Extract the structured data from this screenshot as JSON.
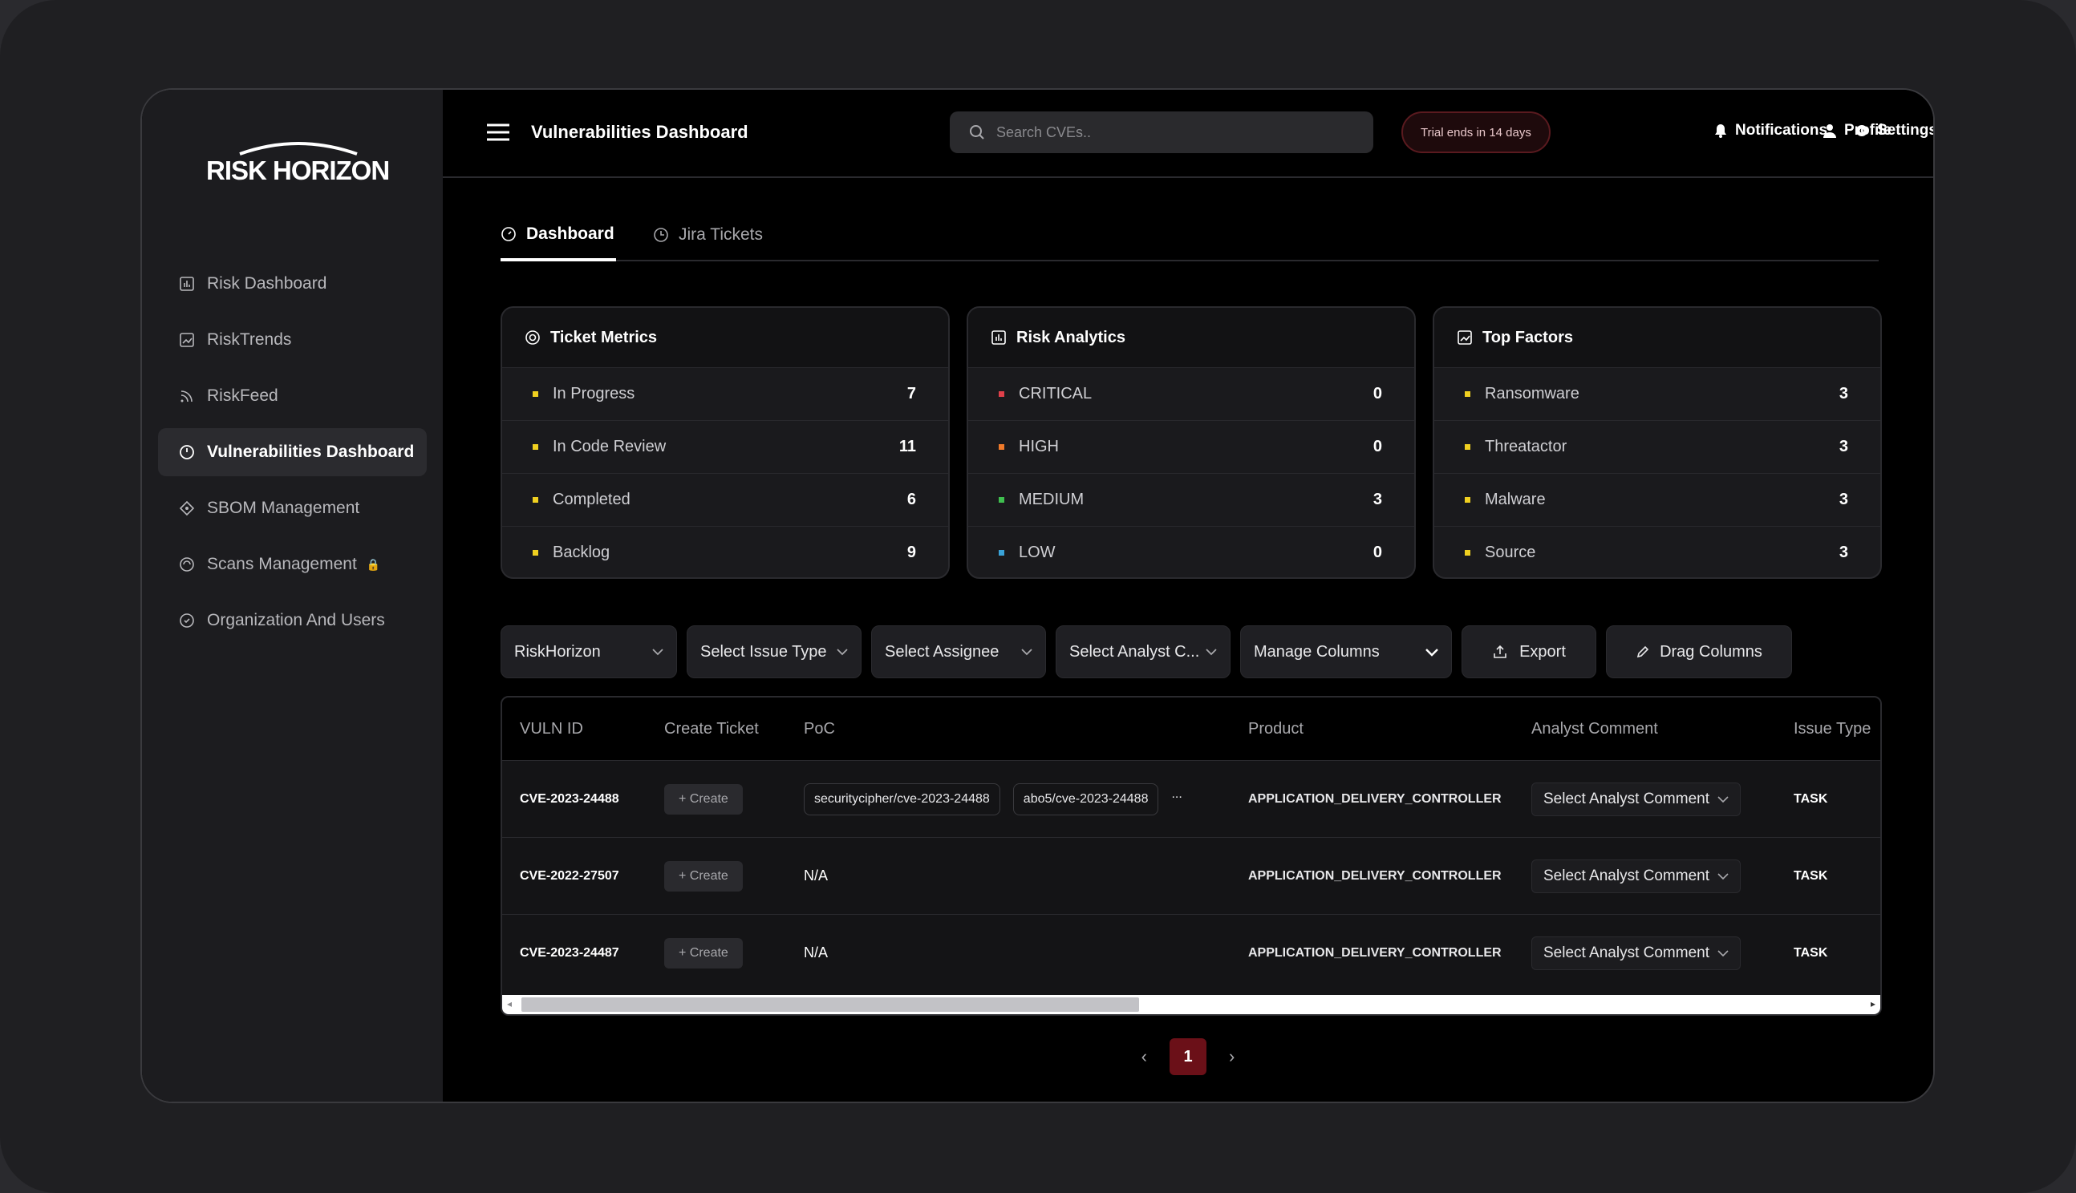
{
  "app": {
    "logo_text": "RISK HORIZON"
  },
  "sidebar": {
    "items": [
      {
        "label": "Risk Dashboard",
        "icon": "bar-chart-icon"
      },
      {
        "label": "RiskTrends",
        "icon": "trend-chart-icon"
      },
      {
        "label": "RiskFeed",
        "icon": "rss-feed-icon"
      },
      {
        "label": "Vulnerabilities Dashboard",
        "icon": "gauge-icon",
        "active": true
      },
      {
        "label": "SBOM Management",
        "icon": "diamond-icon"
      },
      {
        "label": "Scans Management",
        "icon": "scan-icon",
        "locked": true
      },
      {
        "label": "Organization And Users",
        "icon": "users-icon"
      }
    ]
  },
  "header": {
    "title": "Vulnerabilities Dashboard",
    "search_placeholder": "Search CVEs..",
    "trial_badge": "Trial ends in 14 days",
    "notifications": "Notifications",
    "settings": "Settings",
    "profile": "Profile"
  },
  "tabs": {
    "dashboard": "Dashboard",
    "jira": "Jira Tickets"
  },
  "cards": {
    "ticket_metrics": {
      "title": "Ticket Metrics",
      "rows": [
        {
          "label": "In Progress",
          "value": "7"
        },
        {
          "label": "In Code Review",
          "value": "11"
        },
        {
          "label": "Completed",
          "value": "6"
        },
        {
          "label": "Backlog",
          "value": "9"
        }
      ]
    },
    "risk_analytics": {
      "title": "Risk Analytics",
      "rows": [
        {
          "label": "CRITICAL",
          "value": "0",
          "color": "#e0404a"
        },
        {
          "label": "HIGH",
          "value": "0",
          "color": "#f07a2a"
        },
        {
          "label": "MEDIUM",
          "value": "3",
          "color": "#3fbf4f"
        },
        {
          "label": "LOW",
          "value": "0",
          "color": "#3aa3d8"
        }
      ]
    },
    "top_factors": {
      "title": "Top Factors",
      "rows": [
        {
          "label": "Ransomware",
          "value": "3"
        },
        {
          "label": "Threatactor",
          "value": "3"
        },
        {
          "label": "Malware",
          "value": "3"
        },
        {
          "label": "Source",
          "value": "3"
        }
      ]
    },
    "bullet_color": "#f0d020"
  },
  "filters": {
    "org": "RiskHorizon",
    "issue_type": "Select Issue Type",
    "assignee": "Select Assignee",
    "analyst": "Select Analyst C...",
    "manage_columns": "Manage Columns",
    "export": "Export",
    "drag_columns": "Drag Columns"
  },
  "table": {
    "headers": {
      "vuln_id": "VULN ID",
      "create_ticket": "Create Ticket",
      "poc": "PoC",
      "product": "Product",
      "analyst_comment": "Analyst Comment",
      "issue_type": "Issue Type"
    },
    "create_label": "+ Create",
    "comment_placeholder": "Select Analyst Comment",
    "rows": [
      {
        "vuln_id": "CVE-2023-24488",
        "poc": [
          "securitycipher/cve-2023-24488",
          "abo5/cve-2023-24488"
        ],
        "poc_more": "...",
        "product": "APPLICATION_DELIVERY_CONTROLLER",
        "issue_type": "TASK"
      },
      {
        "vuln_id": "CVE-2022-27507",
        "poc_text": "N/A",
        "product": "APPLICATION_DELIVERY_CONTROLLER",
        "issue_type": "TASK"
      },
      {
        "vuln_id": "CVE-2023-24487",
        "poc_text": "N/A",
        "product": "APPLICATION_DELIVERY_CONTROLLER",
        "issue_type": "TASK"
      }
    ]
  },
  "pagination": {
    "current": "1",
    "prev": "‹",
    "next": "›"
  }
}
